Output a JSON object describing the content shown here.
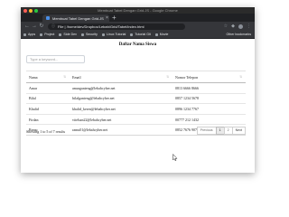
{
  "browser": {
    "window_title": "Membuat Tabel Dengan Grid.JS - Google Chrome",
    "tab_title": "Membuat Tabel Dengan Grid.JS",
    "url": "File | /home/dev/Dropbox/Lebah/Grid/Tabel/index.html",
    "bookmarks": [
      "Apps",
      "Project",
      "Side Dev",
      "Security",
      "Linux Tutorial",
      "Tutorial Git",
      "Movie"
    ],
    "other_bookmarks": "Other bookmarks",
    "icons": [
      "back-icon",
      "forward-icon",
      "reload-icon",
      "star-icon",
      "extension-icon",
      "menu-icon"
    ]
  },
  "page": {
    "heading": "Daftar Nama Siswa",
    "search_placeholder": "Type a keyword...",
    "columns": [
      "Nama",
      "Email",
      "Nomor Telepon"
    ],
    "rows": [
      {
        "nama": "Amar",
        "email": "amarganteng@lebahcyber.net",
        "telepon": "0813 6666 8666"
      },
      {
        "nama": "Bilal",
        "email": "bilalganteng@lebahcyber.net",
        "telepon": "0857 1234 5678"
      },
      {
        "nama": "Khalid",
        "email": "khalid_keren@lebahcyber.net",
        "telepon": "0896 1234 7767"
      },
      {
        "nama": "Firdan",
        "email": "vitelsan22@lebahcyber.net",
        "telepon": "00777 212 1432"
      },
      {
        "nama": "Ramu",
        "email": "ramu01@lebahcyber.net",
        "telepon": "0852 7676 9079"
      }
    ],
    "summary": "Showing 1 to 5 of 7 results",
    "pagination": {
      "previous": "Previous",
      "pages": [
        "1",
        "2"
      ],
      "current": "1",
      "next": "Next"
    }
  },
  "colors": {
    "titlebar": "#2b2b2b",
    "tabstrip": "#202124",
    "toolbar": "#35363a",
    "active_page": "#e9e9e9"
  }
}
